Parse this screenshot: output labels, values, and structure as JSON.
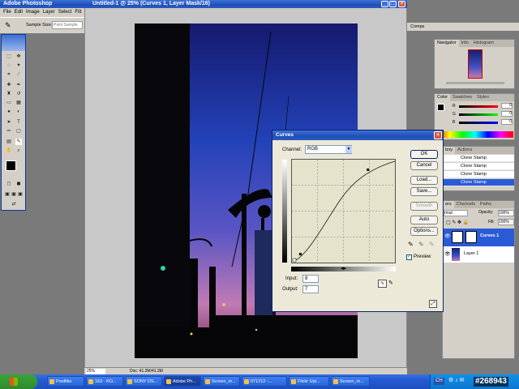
{
  "app": {
    "title": "Adobe Photoshop",
    "menu": [
      "File",
      "Edit",
      "Image",
      "Layer",
      "Select",
      "Filt"
    ]
  },
  "options_bar": {
    "sample_size_label": "Sample Size:",
    "sample_size_value": "Point Sample"
  },
  "document": {
    "title": "Untitled-1 @ 25% (Curves 1, Layer Mask/16)",
    "zoom": "25%",
    "doc_info": "Doc: 41.3M/41.3M"
  },
  "panels": {
    "top_tab": "Comps",
    "navigator_tabs": [
      "Navigator",
      "Info",
      "Histogram"
    ],
    "color_tabs": [
      "Color",
      "Swatches",
      "Styles"
    ],
    "color_channels": [
      {
        "label": "R",
        "value": "0"
      },
      {
        "label": "G",
        "value": "0"
      },
      {
        "label": "B",
        "value": "0"
      }
    ],
    "history_tabs": [
      "tory",
      "Actions"
    ],
    "history_items": [
      "Clone Stamp",
      "Clone Stamp",
      "Clone Stamp",
      "Clone Stamp"
    ],
    "layers_tabs": [
      "ers",
      "Channels",
      "Paths"
    ],
    "blend_mode": "rmal",
    "opacity_label": "Opacity:",
    "opacity_value": "100%",
    "fill_label": "Fill:",
    "fill_value": "100%",
    "layers": [
      "Curves 1",
      "Layer 1"
    ]
  },
  "curves": {
    "title": "Curves",
    "channel_label": "Channel:",
    "channel_value": "RGB",
    "buttons": {
      "ok": "OK",
      "cancel": "Cancel",
      "load": "Load...",
      "save": "Save...",
      "smooth": "Smooth",
      "auto": "Auto",
      "options": "Options..."
    },
    "preview_label": "Preview",
    "input_label": "Input:",
    "input_value": "8",
    "output_label": "Output:",
    "output_value": "7"
  },
  "taskbar": {
    "items": [
      "Postfiks",
      "163 · KO...",
      "SONY DS...",
      "Adobe Ph...",
      "Screen_m...",
      "071212 -...",
      "Flickr Upl...",
      "Screen_m..."
    ],
    "tray_text": "CH",
    "watermark": "#268943"
  }
}
